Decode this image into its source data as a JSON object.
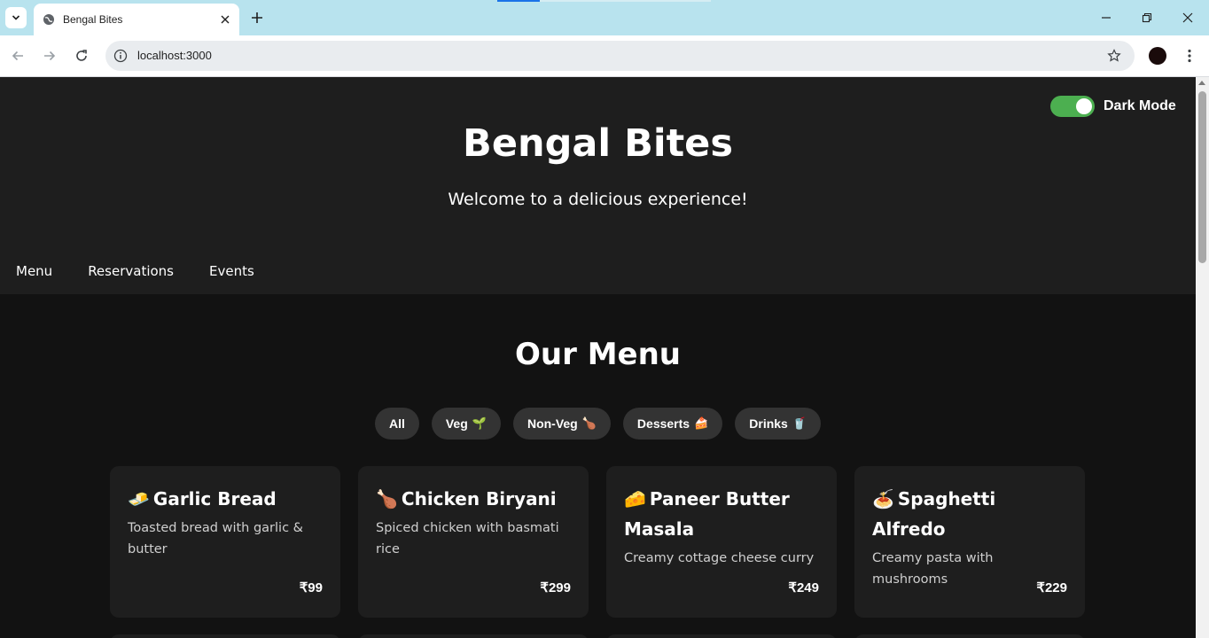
{
  "browser": {
    "tab_title": "Bengal Bites",
    "url": "localhost:3000"
  },
  "header": {
    "dark_mode_label": "Dark Mode",
    "dark_mode_on": true,
    "title": "Bengal Bites",
    "tagline": "Welcome to a delicious experience!",
    "nav": [
      "Menu",
      "Reservations",
      "Events"
    ]
  },
  "menu": {
    "heading": "Our Menu",
    "filters": [
      {
        "label": "All",
        "emoji": ""
      },
      {
        "label": "Veg",
        "emoji": "🌱"
      },
      {
        "label": "Non-Veg",
        "emoji": "🍗"
      },
      {
        "label": "Desserts",
        "emoji": "🍰"
      },
      {
        "label": "Drinks",
        "emoji": "🥤"
      }
    ],
    "items": [
      {
        "emoji": "🧈",
        "name": "Garlic Bread",
        "desc": "Toasted bread with garlic & butter",
        "price": "₹99"
      },
      {
        "emoji": "🍗",
        "name": "Chicken Biryani",
        "desc": "Spiced chicken with basmati rice",
        "price": "₹299"
      },
      {
        "emoji": "🧀",
        "name": "Paneer Butter Masala",
        "desc": "Creamy cottage cheese curry",
        "price": "₹249"
      },
      {
        "emoji": "🍝",
        "name": "Spaghetti Alfredo",
        "desc": "Creamy pasta with mushrooms",
        "price": "₹229"
      }
    ]
  },
  "colors": {
    "toggle_accent": "#4caf50",
    "header_bg": "#1e1e1e",
    "page_bg": "#121212",
    "chip_bg": "#333333",
    "tab_strip_bg": "#b8e3ee"
  }
}
